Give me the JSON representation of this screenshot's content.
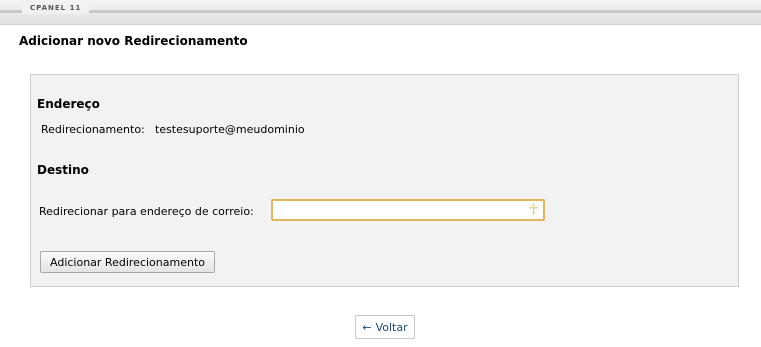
{
  "topbar": {
    "brand": "CPANEL 11"
  },
  "page": {
    "title": "Adicionar novo Redirecionamento"
  },
  "address_section": {
    "title": "Endereço",
    "label": "Redirecionamento:",
    "value": "testesuporte@meudominio"
  },
  "destination_section": {
    "title": "Destino",
    "label": "Redirecionar para endereço de correio:",
    "input_value": "",
    "input_icon": "ankh-icon"
  },
  "buttons": {
    "add_label": "Adicionar Redirecionamento",
    "back_arrow": "←",
    "back_label": "Voltar"
  },
  "colors": {
    "input_focus_border": "#e3b55c",
    "panel_bg": "#f2f2f2",
    "link_color": "#1a4a7a"
  }
}
